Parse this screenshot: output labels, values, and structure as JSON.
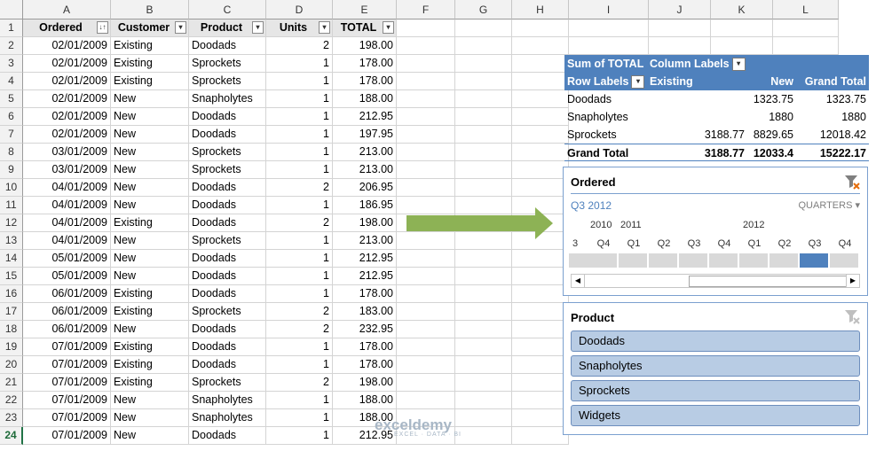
{
  "columns": [
    "A",
    "B",
    "C",
    "D",
    "E",
    "F",
    "G",
    "H",
    "I",
    "J",
    "K",
    "L"
  ],
  "rows": [
    "1",
    "2",
    "3",
    "4",
    "5",
    "6",
    "7",
    "8",
    "9",
    "10",
    "11",
    "12",
    "13",
    "14",
    "15",
    "16",
    "17",
    "18",
    "19",
    "20",
    "21",
    "22",
    "23",
    "24"
  ],
  "table": {
    "headers": [
      "Ordered",
      "Customer",
      "Product",
      "Units",
      "TOTAL"
    ],
    "sort_icon": "↓↑",
    "filter_icon": "▾",
    "data": [
      [
        "02/01/2009",
        "Existing",
        "Doodads",
        "2",
        "198.00"
      ],
      [
        "02/01/2009",
        "Existing",
        "Sprockets",
        "1",
        "178.00"
      ],
      [
        "02/01/2009",
        "Existing",
        "Sprockets",
        "1",
        "178.00"
      ],
      [
        "02/01/2009",
        "New",
        "Snapholytes",
        "1",
        "188.00"
      ],
      [
        "02/01/2009",
        "New",
        "Doodads",
        "1",
        "212.95"
      ],
      [
        "02/01/2009",
        "New",
        "Doodads",
        "1",
        "197.95"
      ],
      [
        "03/01/2009",
        "New",
        "Sprockets",
        "1",
        "213.00"
      ],
      [
        "03/01/2009",
        "New",
        "Sprockets",
        "1",
        "213.00"
      ],
      [
        "04/01/2009",
        "New",
        "Doodads",
        "2",
        "206.95"
      ],
      [
        "04/01/2009",
        "New",
        "Doodads",
        "1",
        "186.95"
      ],
      [
        "04/01/2009",
        "Existing",
        "Doodads",
        "2",
        "198.00"
      ],
      [
        "04/01/2009",
        "New",
        "Sprockets",
        "1",
        "213.00"
      ],
      [
        "05/01/2009",
        "New",
        "Doodads",
        "1",
        "212.95"
      ],
      [
        "05/01/2009",
        "New",
        "Doodads",
        "1",
        "212.95"
      ],
      [
        "06/01/2009",
        "Existing",
        "Doodads",
        "1",
        "178.00"
      ],
      [
        "06/01/2009",
        "Existing",
        "Sprockets",
        "2",
        "183.00"
      ],
      [
        "06/01/2009",
        "New",
        "Doodads",
        "2",
        "232.95"
      ],
      [
        "07/01/2009",
        "Existing",
        "Doodads",
        "1",
        "178.00"
      ],
      [
        "07/01/2009",
        "Existing",
        "Doodads",
        "1",
        "178.00"
      ],
      [
        "07/01/2009",
        "Existing",
        "Sprockets",
        "2",
        "198.00"
      ],
      [
        "07/01/2009",
        "New",
        "Snapholytes",
        "1",
        "188.00"
      ],
      [
        "07/01/2009",
        "New",
        "Snapholytes",
        "1",
        "188.00"
      ],
      [
        "07/01/2009",
        "New",
        "Doodads",
        "1",
        "212.95"
      ]
    ]
  },
  "pivot": {
    "sum_label": "Sum of TOTAL",
    "column_labels": "Column Labels",
    "row_labels": "Row Labels",
    "col_headers": [
      "Existing",
      "New",
      "Grand Total"
    ],
    "rows": [
      {
        "label": "Doodads",
        "existing": "",
        "new": "1323.75",
        "total": "1323.75"
      },
      {
        "label": "Snapholytes",
        "existing": "",
        "new": "1880",
        "total": "1880"
      },
      {
        "label": "Sprockets",
        "existing": "3188.77",
        "new": "8829.65",
        "total": "12018.42"
      }
    ],
    "grand": {
      "label": "Grand Total",
      "existing": "3188.77",
      "new": "12033.4",
      "total": "15222.17"
    }
  },
  "timeline": {
    "title": "Ordered",
    "selection": "Q3 2012",
    "level": "QUARTERS",
    "years": [
      "2010",
      "2011",
      "2012"
    ],
    "quarters": [
      "3",
      "Q4",
      "Q1",
      "Q2",
      "Q3",
      "Q4",
      "Q1",
      "Q2",
      "Q3",
      "Q4"
    ],
    "selected_index": 8
  },
  "slicer": {
    "title": "Product",
    "items": [
      "Doodads",
      "Snapholytes",
      "Sprockets",
      "Widgets"
    ]
  },
  "watermark": {
    "name": "exceldemy",
    "tagline": "EXCEL · DATA · BI"
  },
  "colors": {
    "pivot_header": "#4f81bd",
    "slicer_tile": "#b8cce4",
    "arrow": "#8db255",
    "timeline_selected": "#4f81bd"
  }
}
